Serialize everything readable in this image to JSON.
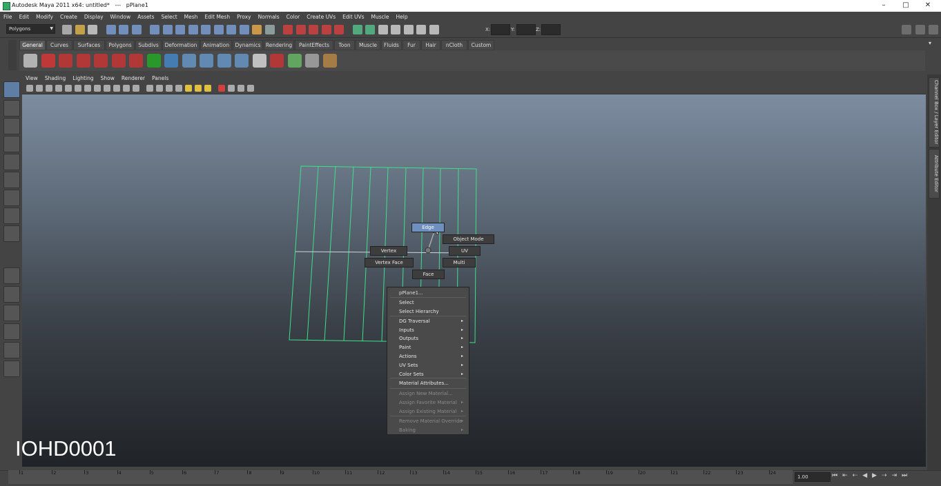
{
  "window": {
    "title": "Autodesk Maya 2011 x64: untitled*   ---   pPlane1",
    "minimize": "–",
    "maximize": "□",
    "close": "✕"
  },
  "menus": [
    "File",
    "Edit",
    "Modify",
    "Create",
    "Display",
    "Window",
    "Assets",
    "Select",
    "Mesh",
    "Edit Mesh",
    "Proxy",
    "Normals",
    "Color",
    "Create UVs",
    "Edit UVs",
    "Muscle",
    "Help"
  ],
  "status_line": {
    "menu_set": "Polygons",
    "x_label": "X:",
    "y_label": "Y:",
    "z_label": "Z:"
  },
  "shelf_tabs": [
    "General",
    "Curves",
    "Surfaces",
    "Polygons",
    "Subdivs",
    "Deformation",
    "Animation",
    "Dynamics",
    "Rendering",
    "PaintEffects",
    "Toon",
    "Muscle",
    "Fluids",
    "Fur",
    "Hair",
    "nCloth",
    "Custom"
  ],
  "shelf_active_tab": "General",
  "panel_menus": [
    "View",
    "Shading",
    "Lighting",
    "Show",
    "Renderer",
    "Panels"
  ],
  "right_tabs": [
    "Channel Box / Layer Editor",
    "Attribute Editor"
  ],
  "marking_menu": {
    "edge": "Edge",
    "object_mode": "Object Mode",
    "vertex": "Vertex",
    "uv": "UV",
    "vertex_face": "Vertex Face",
    "multi": "Multi",
    "face": "Face"
  },
  "context_menu": {
    "header": "pPlane1...",
    "items": [
      {
        "label": "Select",
        "submenu": false,
        "enabled": true
      },
      {
        "label": "Select Hierarchy",
        "submenu": false,
        "enabled": true
      },
      {
        "label": "DG Traversal",
        "submenu": true,
        "enabled": true
      },
      {
        "label": "Inputs",
        "submenu": true,
        "enabled": true
      },
      {
        "label": "Outputs",
        "submenu": true,
        "enabled": true
      },
      {
        "label": "Paint",
        "submenu": true,
        "enabled": true
      },
      {
        "label": "Actions",
        "submenu": true,
        "enabled": true
      },
      {
        "label": "UV Sets",
        "submenu": true,
        "enabled": true
      },
      {
        "label": "Color Sets",
        "submenu": true,
        "enabled": true
      },
      {
        "label": "Material Attributes...",
        "submenu": false,
        "enabled": true
      },
      {
        "label": "Assign New Material...",
        "submenu": false,
        "enabled": false
      },
      {
        "label": "Assign Favorite Material",
        "submenu": true,
        "enabled": false
      },
      {
        "label": "Assign Existing Material",
        "submenu": true,
        "enabled": false
      },
      {
        "label": "Remove Material Override",
        "submenu": true,
        "enabled": false
      },
      {
        "label": "Baking",
        "submenu": true,
        "enabled": false
      }
    ]
  },
  "timeline": {
    "ticks": [
      "1",
      "2",
      "3",
      "4",
      "5",
      "6",
      "7",
      "8",
      "9",
      "10",
      "11",
      "12",
      "13",
      "14",
      "15",
      "16",
      "17",
      "18",
      "19",
      "20",
      "21",
      "22",
      "23",
      "24"
    ],
    "current_frame": "1.00"
  },
  "watermark": "IOHD0001",
  "colors": {
    "selection_blue": "#6f8fbf",
    "wireframe_green": "#3fe08a"
  }
}
